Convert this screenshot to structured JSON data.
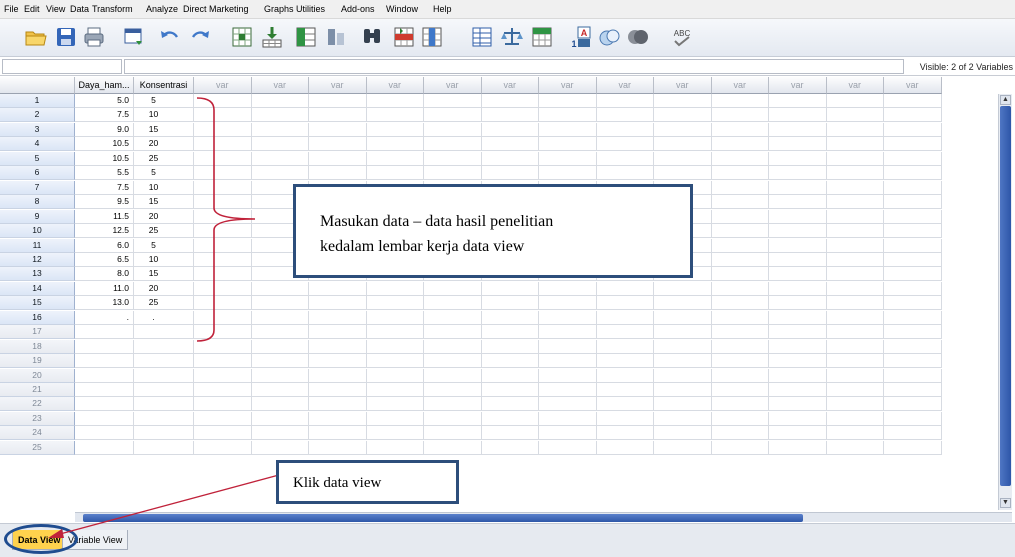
{
  "menu": [
    "File",
    "Edit",
    "View",
    "Data",
    "Transform",
    "Analyze",
    "Direct Marketing",
    "Graphs",
    "Utilities",
    "Add-ons",
    "Window",
    "Help"
  ],
  "toolbar_icons": [
    "open-icon",
    "save-icon",
    "print-icon",
    "recall-dialog-icon",
    "undo-icon",
    "redo-icon",
    "goto-case-icon",
    "goto-variable-icon",
    "variables-icon",
    "run-descriptives-icon",
    "find-icon",
    "insert-cases-icon",
    "insert-variable-icon",
    "split-file-icon",
    "weight-cases-icon",
    "select-cases-icon",
    "value-labels-icon",
    "use-sets-icon",
    "show-all-variables-icon",
    "spell-check-icon"
  ],
  "toolbar_text": {
    "value_labels": "A",
    "value_labels_num": "1",
    "spell": "ABC"
  },
  "status": {
    "visible": "Visible: 2 of 2 Variables"
  },
  "columns": [
    "Daya_ham...",
    "Konsentrasi",
    "var",
    "var",
    "var",
    "var",
    "var",
    "var",
    "var",
    "var",
    "var",
    "var",
    "var",
    "var",
    "var"
  ],
  "rows": [
    {
      "n": "1",
      "a": "5.0",
      "b": "5"
    },
    {
      "n": "2",
      "a": "7.5",
      "b": "10"
    },
    {
      "n": "3",
      "a": "9.0",
      "b": "15"
    },
    {
      "n": "4",
      "a": "10.5",
      "b": "20"
    },
    {
      "n": "5",
      "a": "10.5",
      "b": "25"
    },
    {
      "n": "6",
      "a": "5.5",
      "b": "5"
    },
    {
      "n": "7",
      "a": "7.5",
      "b": "10"
    },
    {
      "n": "8",
      "a": "9.5",
      "b": "15"
    },
    {
      "n": "9",
      "a": "11.5",
      "b": "20"
    },
    {
      "n": "10",
      "a": "12.5",
      "b": "25"
    },
    {
      "n": "11",
      "a": "6.0",
      "b": "5"
    },
    {
      "n": "12",
      "a": "6.5",
      "b": "10"
    },
    {
      "n": "13",
      "a": "8.0",
      "b": "15"
    },
    {
      "n": "14",
      "a": "11.0",
      "b": "20"
    },
    {
      "n": "15",
      "a": "13.0",
      "b": "25"
    },
    {
      "n": "16",
      "a": ".",
      "b": "."
    },
    {
      "n": "17",
      "a": "",
      "b": ""
    },
    {
      "n": "18",
      "a": "",
      "b": ""
    },
    {
      "n": "19",
      "a": "",
      "b": ""
    },
    {
      "n": "20",
      "a": "",
      "b": ""
    },
    {
      "n": "21",
      "a": "",
      "b": ""
    },
    {
      "n": "22",
      "a": "",
      "b": ""
    },
    {
      "n": "23",
      "a": "",
      "b": ""
    },
    {
      "n": "24",
      "a": "",
      "b": ""
    },
    {
      "n": "25",
      "a": "",
      "b": ""
    }
  ],
  "tabs": {
    "data_view": "Data View",
    "variable_view": "Variable View"
  },
  "annotations": {
    "note1_line1": "Masukan data – data  hasil penelitian",
    "note1_line2": "kedalam lembar kerja data view",
    "note2": "Klik data view"
  },
  "colors": {
    "annotation_border": "#2d4e7b",
    "bracket": "#c0223a",
    "tab_highlight": "#ffd24d",
    "circle": "#1f4c8f"
  }
}
